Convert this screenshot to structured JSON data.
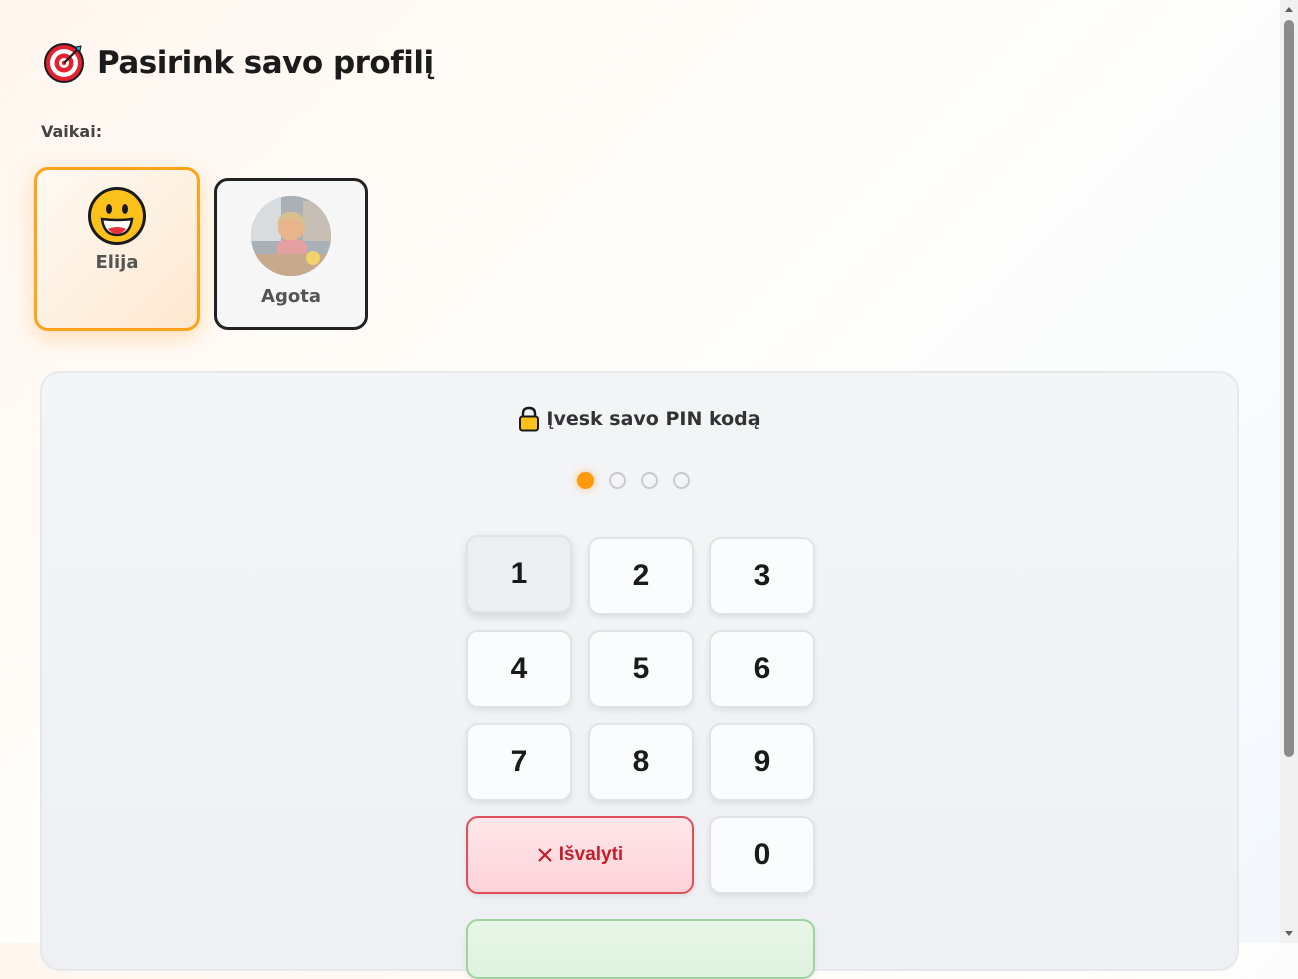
{
  "header": {
    "title": "Pasirink savo profilį",
    "icon": "target-icon"
  },
  "section": {
    "children_label": "Vaikai:"
  },
  "profiles": [
    {
      "name": "Elija",
      "avatar": "grinning-face-icon",
      "selected": true
    },
    {
      "name": "Agota",
      "avatar": "photo",
      "selected": false
    }
  ],
  "pin": {
    "title": "Įvesk savo PIN kodą",
    "icon": "lock-icon",
    "length": 4,
    "entered": 1,
    "keys": [
      "1",
      "2",
      "3",
      "4",
      "5",
      "6",
      "7",
      "8",
      "9",
      "0"
    ],
    "clear_label": "Išvalyti",
    "clear_icon": "close-icon"
  },
  "colors": {
    "accent": "#ffa31a",
    "pin_dot": "#ff9a0c",
    "clear": "#c41e2a",
    "submit": "#9ed39f"
  }
}
